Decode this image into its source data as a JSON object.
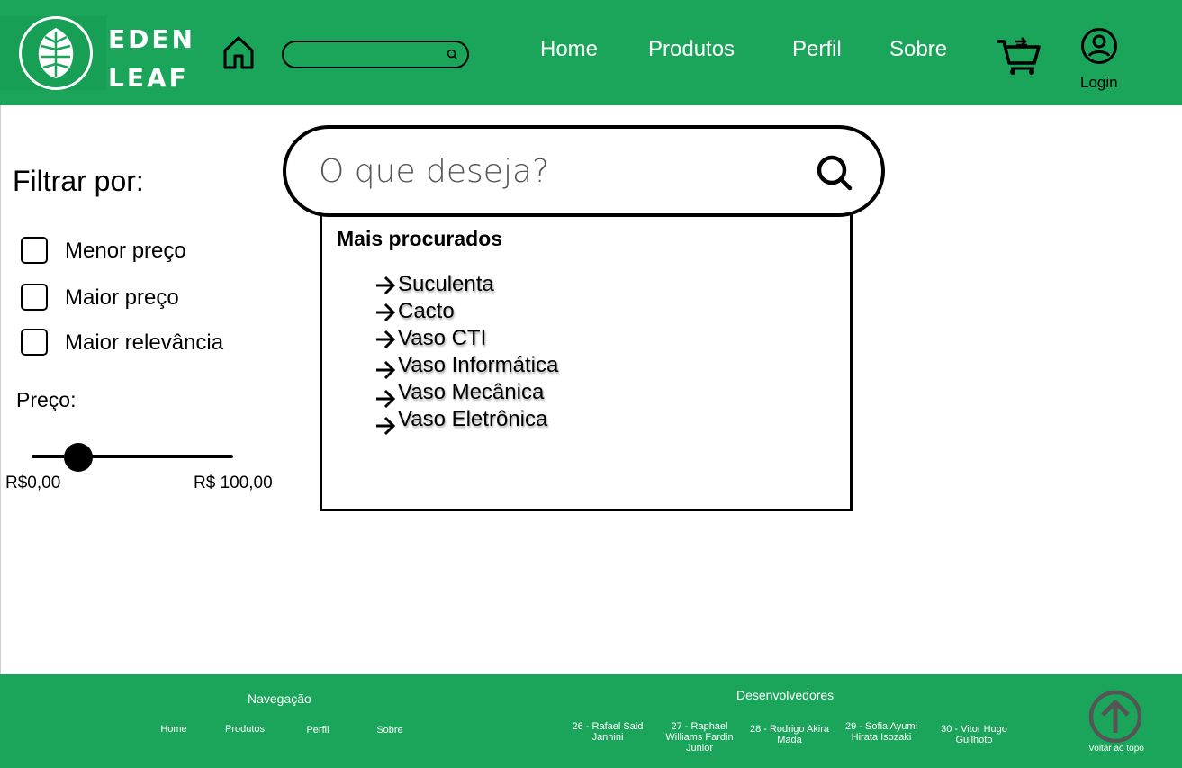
{
  "brand": {
    "line1": "EDEN",
    "line2": "LEAF"
  },
  "header": {
    "nav": [
      "Home",
      "Produtos",
      "Perfil",
      "Sobre"
    ],
    "login_label": "Login"
  },
  "search": {
    "placeholder": "O que deseja?"
  },
  "suggestions": {
    "title": "Mais procurados",
    "items": [
      "Suculenta",
      "Cacto",
      "Vaso CTI",
      "Vaso Informática",
      "Vaso Mecânica",
      "Vaso Eletrônica"
    ]
  },
  "filter": {
    "title": "Filtrar por:",
    "options": [
      "Menor preço",
      "Maior preço",
      "Maior relevância"
    ],
    "price_label": "Preço:",
    "price_min": "R$0,00",
    "price_max": "R$ 100,00",
    "slider_value_fraction": 0.23
  },
  "footer": {
    "nav_title": "Navegação",
    "nav_links": [
      "Home",
      "Produtos",
      "Perfil",
      "Sobre"
    ],
    "dev_title": "Desenvolvedores",
    "devs": [
      "26 - Rafael Said Jannini",
      "27 - Raphael Williams Fardin Junior",
      "28 - Rodrigo Akira Mada",
      "29 - Sofia Ayumi Hirata Isozaki",
      "30 - Vitor Hugo Guilhoto"
    ],
    "back_to_top": "Voltar ao topo"
  },
  "colors": {
    "brand_green": "#1aa55a",
    "text": "#000000"
  }
}
